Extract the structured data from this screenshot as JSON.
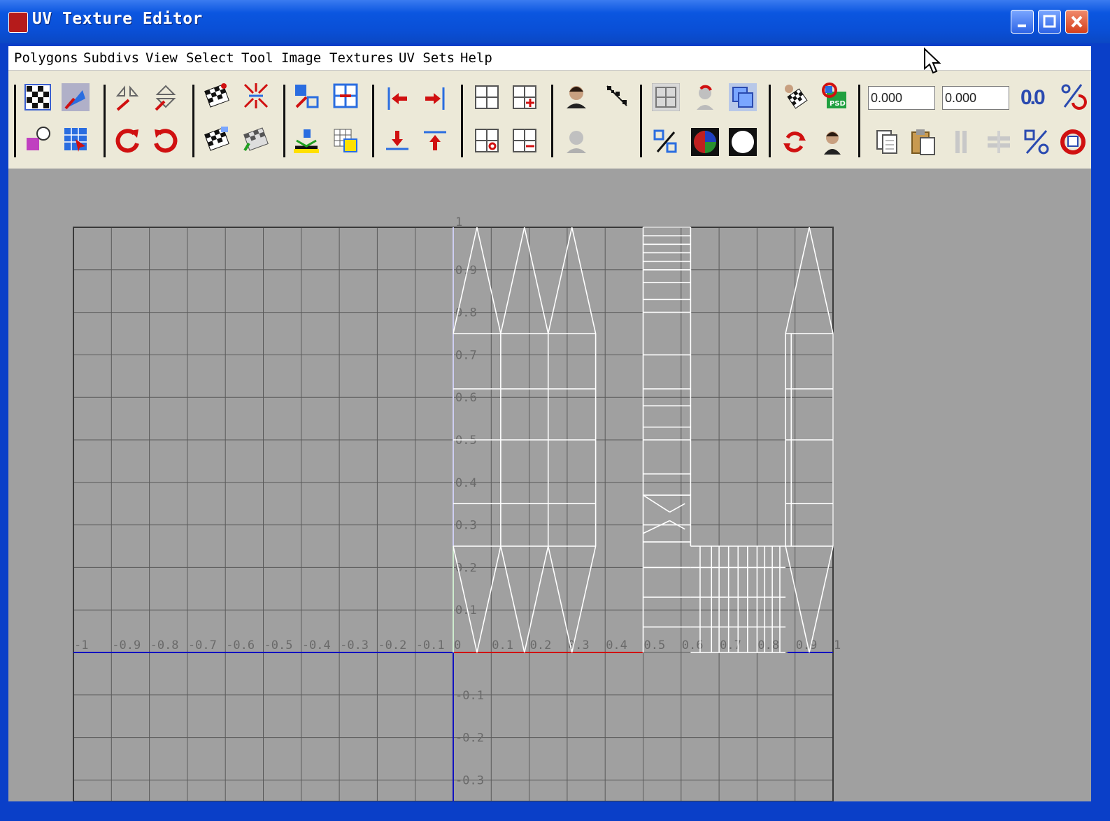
{
  "window": {
    "title": "UV Texture Editor"
  },
  "menubar": {
    "items": [
      "Polygons",
      "Subdivs",
      "View",
      "Select",
      "Tool",
      "Image",
      "Textures",
      "UV Sets",
      "Help"
    ]
  },
  "toolbar": {
    "u_value": "0.000",
    "v_value": "0.000",
    "precision_label": "0.0"
  },
  "grid": {
    "x_labels": [
      "-1",
      "-0.9",
      "-0.8",
      "-0.7",
      "-0.6",
      "-0.5",
      "-0.4",
      "-0.3",
      "-0.2",
      "-0.1",
      "0",
      "0.1",
      "0.2",
      "0.3",
      "0.4",
      "0.5",
      "0.6",
      "0.7",
      "0.8",
      "0.9",
      "1"
    ],
    "y_labels": [
      "1",
      "0.9",
      "0.8",
      "0.7",
      "0.6",
      "0.5",
      "0.4",
      "0.3",
      "0.2",
      "0.1",
      "-0.1",
      "-0.2",
      "-0.3"
    ],
    "u_range": [
      -1,
      1
    ],
    "v_range": [
      -0.35,
      1
    ]
  },
  "colors": {
    "title_bar": "#0a4fd6",
    "viewport_bg": "#a0a0a0",
    "grid_line": "#5a5a5a",
    "wireframe": "#ffffff",
    "axis_u": "#d01010",
    "axis_v": "#10a010",
    "axis_zero": "#1010c0"
  }
}
